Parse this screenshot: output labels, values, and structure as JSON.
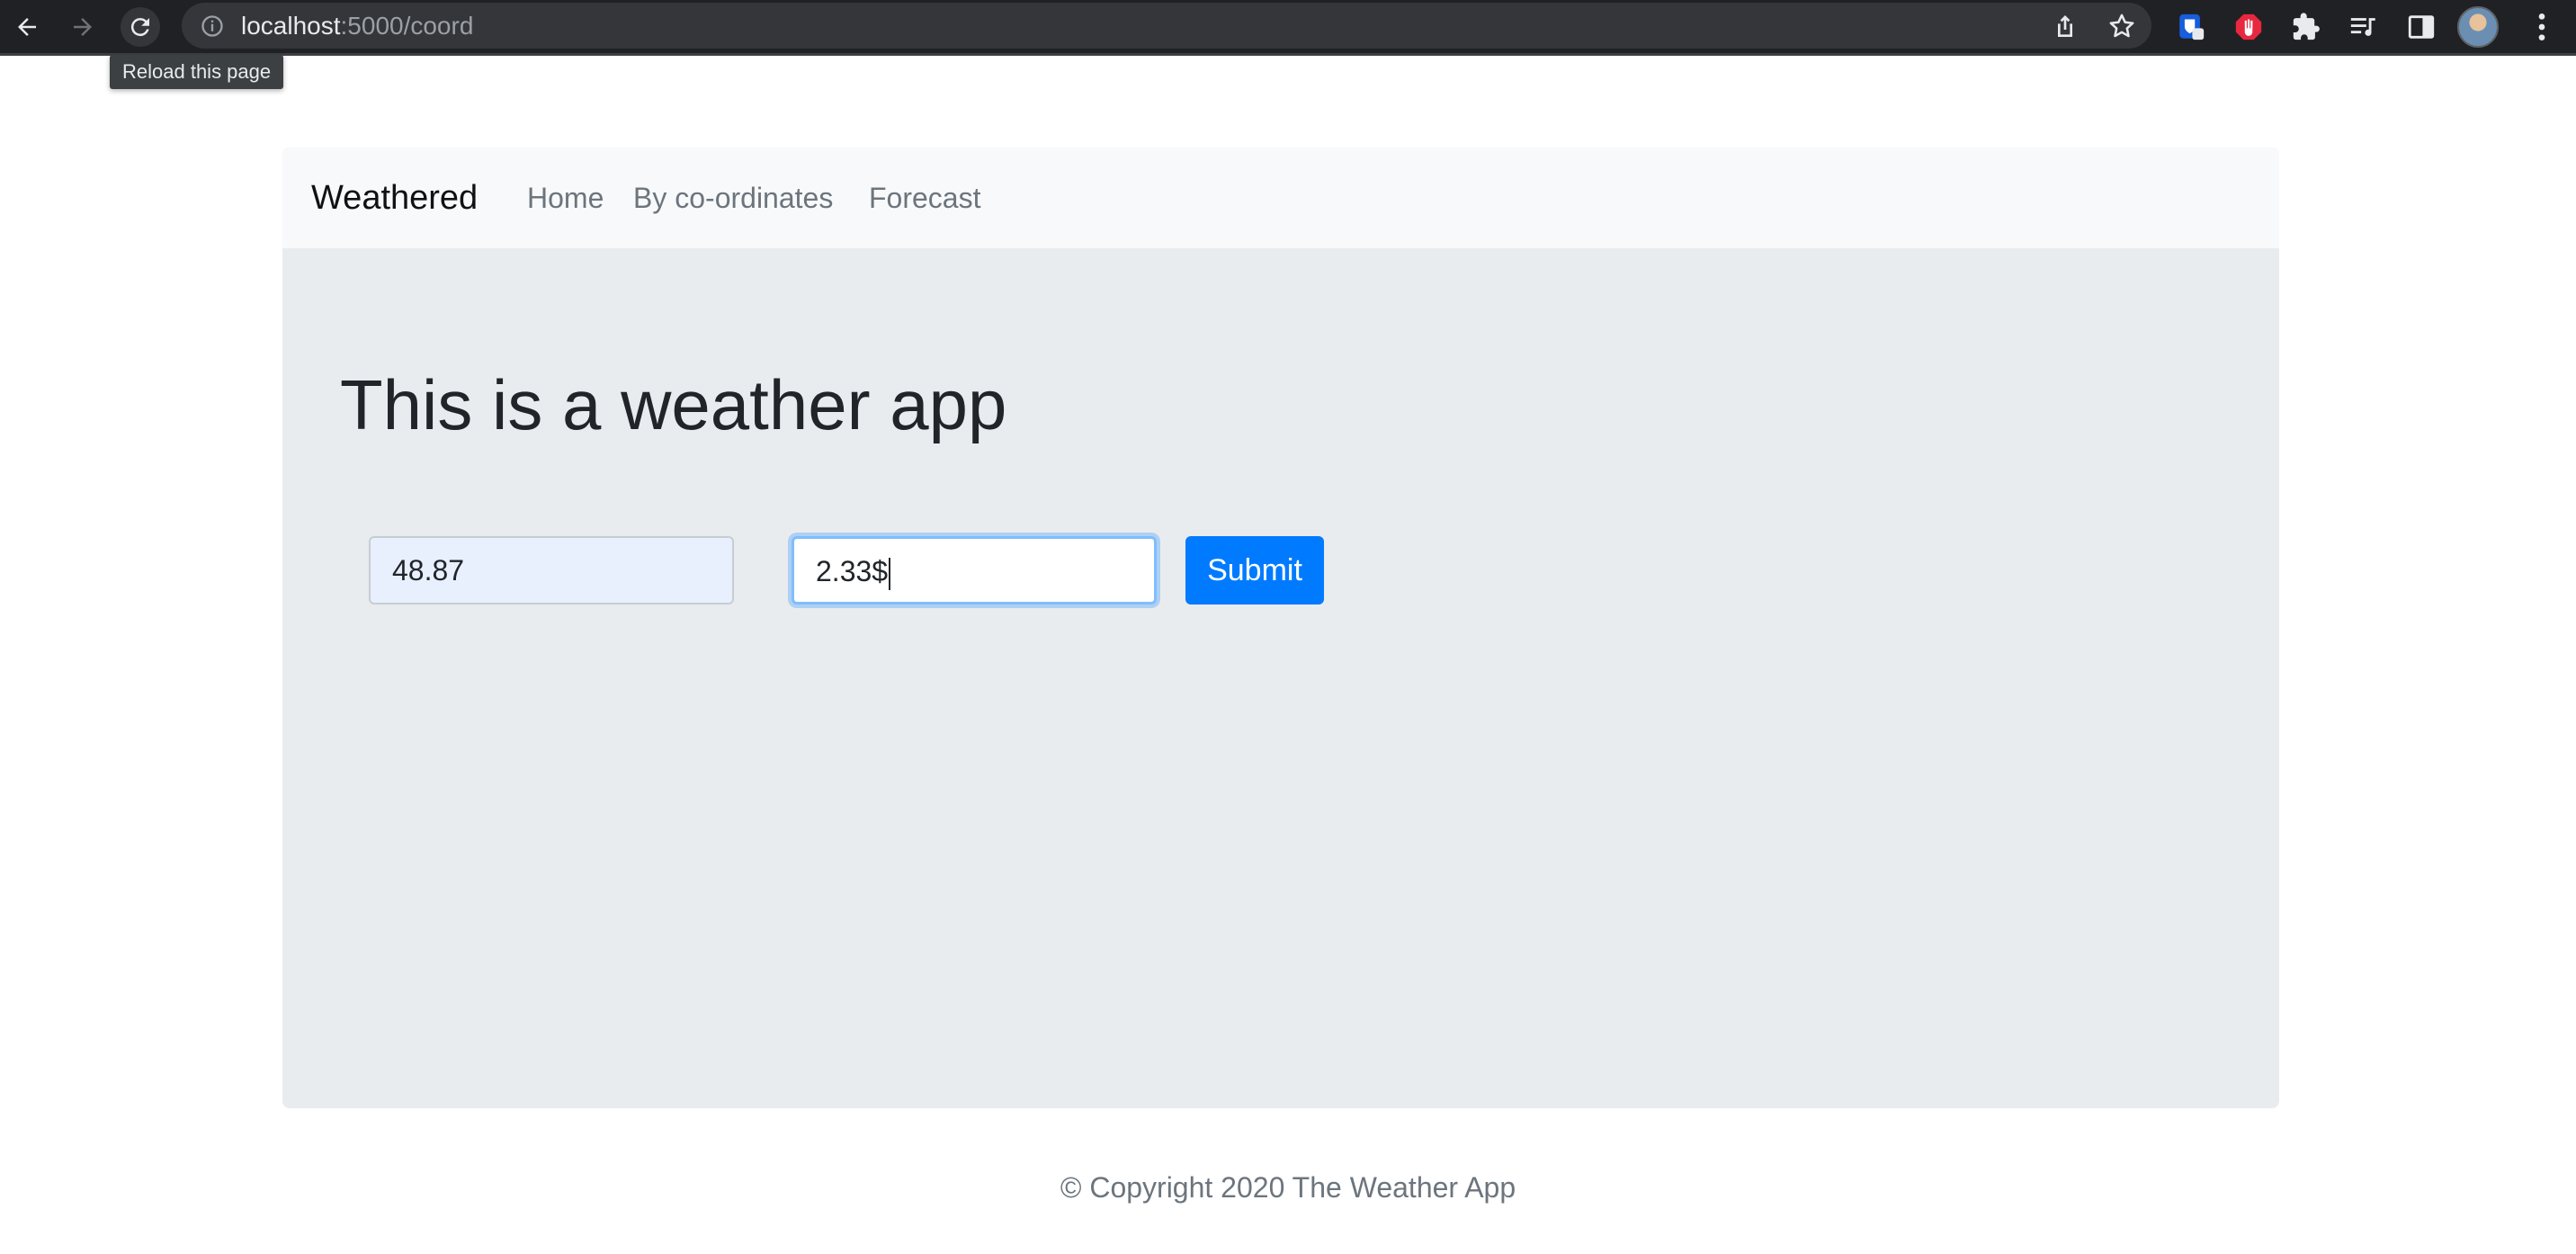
{
  "browser": {
    "url_host": "localhost",
    "url_path": ":5000/coord",
    "tooltip": "Reload this page",
    "icons": [
      "back-icon",
      "forward-icon",
      "reload-icon",
      "info-icon",
      "share-icon",
      "star-icon",
      "bitwarden-icon",
      "adblock-icon",
      "puzzle-extensions-icon",
      "media-playlist-icon",
      "side-panel-icon",
      "avatar",
      "kebab-menu-icon"
    ]
  },
  "navbar": {
    "brand": "Weathered",
    "links": [
      {
        "label": "Home"
      },
      {
        "label": "By co-ordinates"
      },
      {
        "label": "Forecast"
      }
    ]
  },
  "main": {
    "headline": "This is a weather app",
    "latitude_value": "48.87",
    "longitude_value": "2.33$",
    "submit_label": "Submit"
  },
  "footer": {
    "text": "© Copyright 2020 The Weather App"
  },
  "colors": {
    "primary": "#007bff",
    "jumbotron_bg": "#e9ecef",
    "navbar_bg": "#f8f9fa",
    "browser_bg": "#202124"
  }
}
